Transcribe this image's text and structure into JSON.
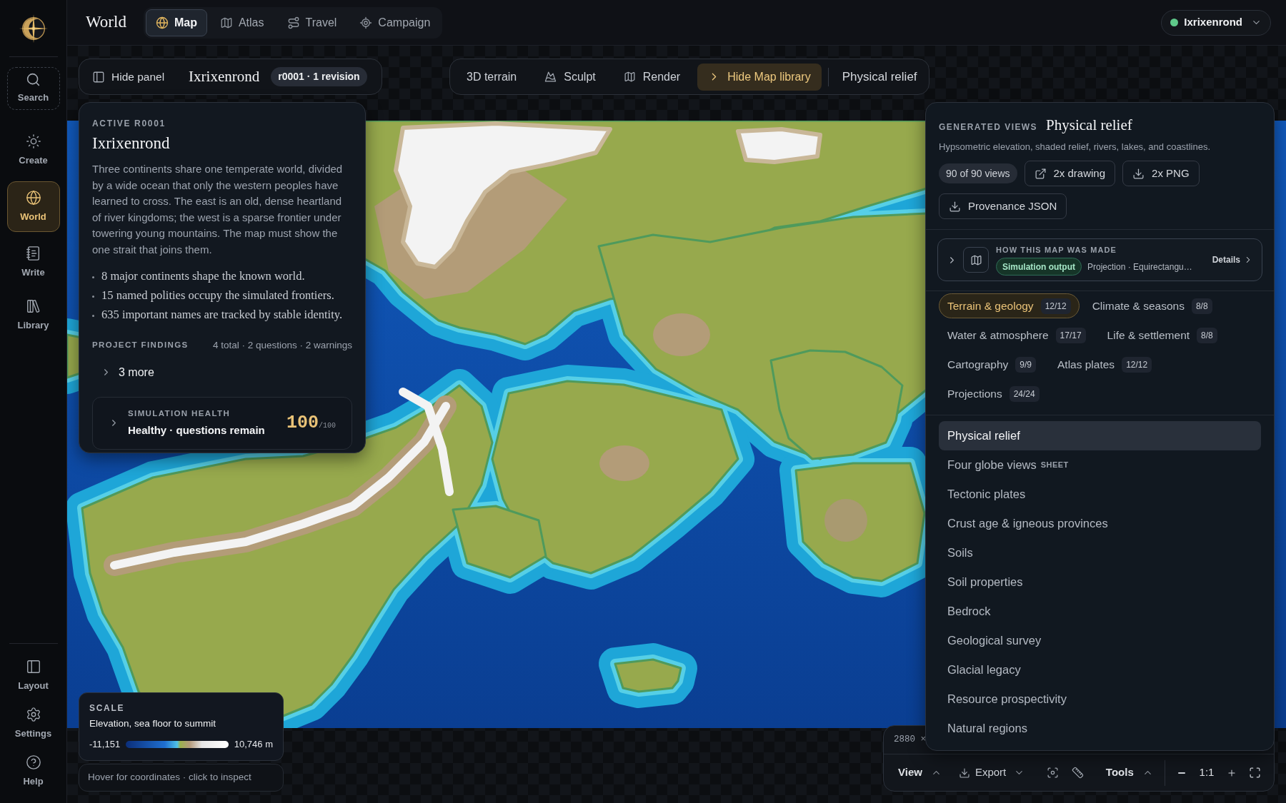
{
  "sidebar": {
    "search": {
      "label": "Search"
    },
    "items": [
      {
        "label": "Create",
        "selected": false
      },
      {
        "label": "World",
        "selected": true
      },
      {
        "label": "Write",
        "selected": false
      },
      {
        "label": "Library",
        "selected": false
      }
    ],
    "footer_items": [
      {
        "label": "Layout"
      },
      {
        "label": "Settings"
      },
      {
        "label": "Help"
      }
    ]
  },
  "header": {
    "title": "World",
    "tabs": [
      {
        "label": "Map",
        "selected": true
      },
      {
        "label": "Atlas",
        "selected": false
      },
      {
        "label": "Travel",
        "selected": false
      },
      {
        "label": "Campaign",
        "selected": false
      }
    ],
    "project_switcher": {
      "label": "Ixrixenrond"
    }
  },
  "panel_bar": {
    "toggle": "Hide panel",
    "project_name": "Ixrixenrond",
    "revision": "r0001 · 1 revision"
  },
  "map_tools": {
    "buttons": [
      {
        "label": "3D terrain",
        "selected": false
      },
      {
        "label": "Sculpt",
        "selected": false
      },
      {
        "label": "Render",
        "selected": false
      },
      {
        "label": "Hide Map library",
        "selected": true
      }
    ],
    "current_view": "Physical relief"
  },
  "project_card": {
    "eyebrow": "ACTIVE R0001",
    "title": "Ixrixenrond",
    "description": "Three continents share one temperate world, divided by a wide ocean that only the western peoples have learned to cross. The east is an old, dense heartland of river kingdoms; the west is a sparse frontier under towering young mountains. The map must show the one strait that joins them.",
    "facts": [
      "8 major continents shape the known world.",
      "15 named polities occupy the simulated frontiers.",
      "635 important names are tracked by stable identity."
    ],
    "findings": {
      "label": "PROJECT FINDINGS",
      "summary": "4 total · 2 questions · 2 warnings",
      "more": "3 more"
    },
    "health": {
      "label": "SIMULATION HEALTH",
      "status": "Healthy · questions remain",
      "score": "100",
      "max": "/100"
    }
  },
  "map_library": {
    "eyebrow": "GENERATED VIEWS",
    "title": "Physical relief",
    "description": "Hypsometric elevation, shaded relief, rivers, lakes, and coastlines.",
    "count": "90 of 90 views",
    "actions": [
      {
        "label": "2x drawing"
      },
      {
        "label": "2x PNG"
      },
      {
        "label": "Provenance JSON"
      }
    ],
    "provenance": {
      "label": "HOW THIS MAP WAS MADE",
      "source": "Simulation output",
      "projection": "Projection · Equirectangu…",
      "details": "Details"
    },
    "categories": [
      {
        "label": "Terrain & geology",
        "count": "12/12",
        "selected": true
      },
      {
        "label": "Climate & seasons",
        "count": "8/8",
        "selected": false
      },
      {
        "label": "Water & atmosphere",
        "count": "17/17",
        "selected": false
      },
      {
        "label": "Life & settlement",
        "count": "8/8",
        "selected": false
      },
      {
        "label": "Cartography",
        "count": "9/9",
        "selected": false
      },
      {
        "label": "Atlas plates",
        "count": "12/12",
        "selected": false
      },
      {
        "label": "Projections",
        "count": "24/24",
        "selected": false
      }
    ],
    "views": [
      {
        "label": "Physical relief",
        "selected": true
      },
      {
        "label": "Four globe views",
        "tag": "SHEET",
        "selected": false
      },
      {
        "label": "Tectonic plates",
        "selected": false
      },
      {
        "label": "Crust age & igneous provinces",
        "selected": false
      },
      {
        "label": "Soils",
        "selected": false
      },
      {
        "label": "Soil properties",
        "selected": false
      },
      {
        "label": "Bedrock",
        "selected": false
      },
      {
        "label": "Geological survey",
        "selected": false
      },
      {
        "label": "Glacial legacy",
        "selected": false
      },
      {
        "label": "Resource prospectivity",
        "selected": false
      },
      {
        "label": "Natural regions",
        "selected": false
      }
    ]
  },
  "scale_legend": {
    "title": "SCALE",
    "subtitle": "Elevation, sea floor to summit",
    "min": "-11,151",
    "max": "10,746 m"
  },
  "hint": "Hover for coordinates · click to inspect",
  "view_toolbar": {
    "dimensions": "2880 ×",
    "view": "View",
    "export": "Export",
    "tools": "Tools",
    "zoom": "1:1"
  }
}
